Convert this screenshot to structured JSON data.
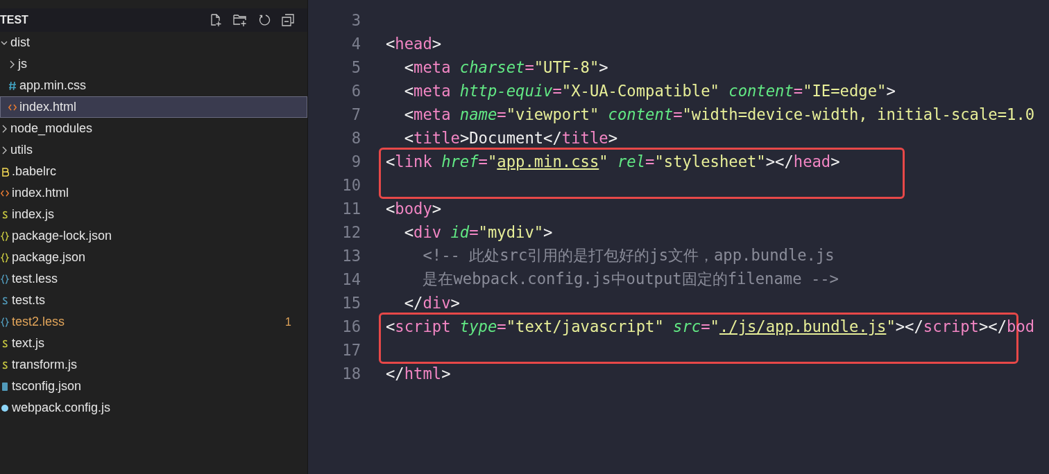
{
  "explorer": {
    "title": "TEST",
    "tree": [
      {
        "name": "dist",
        "kind": "folder",
        "expanded": true,
        "selected": false,
        "children": [
          {
            "name": "js",
            "kind": "folder",
            "expanded": false,
            "selected": false
          },
          {
            "name": "app.min.css",
            "kind": "css",
            "selected": false
          },
          {
            "name": "index.html",
            "kind": "html",
            "selected": true
          }
        ]
      },
      {
        "name": "node_modules",
        "kind": "folder",
        "expanded": false,
        "selected": false
      },
      {
        "name": "utils",
        "kind": "folder",
        "expanded": false,
        "selected": false
      },
      {
        "name": ".babelrc",
        "kind": "babel",
        "selected": false
      },
      {
        "name": "index.html",
        "kind": "html",
        "selected": false
      },
      {
        "name": "index.js",
        "kind": "js",
        "selected": false
      },
      {
        "name": "package-lock.json",
        "kind": "json",
        "selected": false
      },
      {
        "name": "package.json",
        "kind": "json",
        "selected": false
      },
      {
        "name": "test.less",
        "kind": "less",
        "selected": false
      },
      {
        "name": "test.ts",
        "kind": "ts",
        "selected": false
      },
      {
        "name": "test2.less",
        "kind": "less",
        "selected": false,
        "warning": true,
        "badge": "1"
      },
      {
        "name": "text.js",
        "kind": "js",
        "selected": false
      },
      {
        "name": "transform.js",
        "kind": "js",
        "selected": false
      },
      {
        "name": "tsconfig.json",
        "kind": "tsconfig",
        "selected": false
      },
      {
        "name": "webpack.config.js",
        "kind": "webpack",
        "selected": false
      }
    ]
  },
  "editor": {
    "blocks": [
      {
        "kind": "plain",
        "lines": [
          {
            "number": "3"
          },
          {
            "number": "4",
            "tokens": [
              {
                "kind": "punct",
                "text": "<"
              },
              {
                "kind": "tag",
                "text": "head"
              },
              {
                "kind": "punct",
                "text": ">"
              }
            ]
          },
          {
            "number": "5",
            "tokens": [
              {
                "kind": "punct",
                "text": "  <"
              },
              {
                "kind": "tag",
                "text": "meta"
              },
              {
                "kind": "attr",
                "text": " charset"
              },
              {
                "kind": "tag",
                "text": "="
              },
              {
                "kind": "string",
                "text": "\"UTF-8\""
              },
              {
                "kind": "punct",
                "text": ">"
              }
            ]
          },
          {
            "number": "6",
            "tokens": [
              {
                "kind": "punct",
                "text": "  <"
              },
              {
                "kind": "tag",
                "text": "meta"
              },
              {
                "kind": "attr",
                "text": " http-equiv"
              },
              {
                "kind": "tag",
                "text": "="
              },
              {
                "kind": "string",
                "text": "\"X-UA-Compatible\""
              },
              {
                "kind": "attr",
                "text": " content"
              },
              {
                "kind": "tag",
                "text": "="
              },
              {
                "kind": "string",
                "text": "\"IE=edge\""
              },
              {
                "kind": "punct",
                "text": ">"
              }
            ]
          },
          {
            "number": "7",
            "tokens": [
              {
                "kind": "punct",
                "text": "  <"
              },
              {
                "kind": "tag",
                "text": "meta"
              },
              {
                "kind": "attr",
                "text": " name"
              },
              {
                "kind": "tag",
                "text": "="
              },
              {
                "kind": "string",
                "text": "\"viewport\""
              },
              {
                "kind": "attr",
                "text": " content"
              },
              {
                "kind": "tag",
                "text": "="
              },
              {
                "kind": "string",
                "text": "\"width=device-width, initial-scale=1.0"
              }
            ]
          },
          {
            "number": "8",
            "tokens": [
              {
                "kind": "punct",
                "text": "  <"
              },
              {
                "kind": "tag",
                "text": "title"
              },
              {
                "kind": "punct",
                "text": ">Document</"
              },
              {
                "kind": "tag",
                "text": "title"
              },
              {
                "kind": "punct",
                "text": ">"
              }
            ]
          }
        ]
      },
      {
        "kind": "boxed",
        "lines": [
          {
            "number": "9",
            "tokens": [
              {
                "kind": "punct",
                "text": "<"
              },
              {
                "kind": "tag",
                "text": "link"
              },
              {
                "kind": "attr",
                "text": " href"
              },
              {
                "kind": "tag",
                "text": "="
              },
              {
                "kind": "string",
                "text": "\""
              },
              {
                "kind": "link",
                "text": "app.min.css"
              },
              {
                "kind": "string",
                "text": "\""
              },
              {
                "kind": "attr",
                "text": " rel"
              },
              {
                "kind": "tag",
                "text": "="
              },
              {
                "kind": "string",
                "text": "\"stylesheet\""
              },
              {
                "kind": "punct",
                "text": "></"
              },
              {
                "kind": "tag",
                "text": "head"
              },
              {
                "kind": "punct",
                "text": ">"
              }
            ]
          },
          {
            "number": "10"
          }
        ]
      },
      {
        "kind": "plain",
        "lines": [
          {
            "number": "11",
            "tokens": [
              {
                "kind": "punct",
                "text": "<"
              },
              {
                "kind": "tag",
                "text": "body"
              },
              {
                "kind": "punct",
                "text": ">"
              }
            ]
          },
          {
            "number": "12",
            "tokens": [
              {
                "kind": "punct",
                "text": "  <"
              },
              {
                "kind": "tag",
                "text": "div"
              },
              {
                "kind": "attr",
                "text": " id"
              },
              {
                "kind": "tag",
                "text": "="
              },
              {
                "kind": "string",
                "text": "\"mydiv\""
              },
              {
                "kind": "punct",
                "text": ">"
              }
            ]
          },
          {
            "number": "13",
            "tokens": [
              {
                "kind": "comment",
                "text": "    <!-- 此处src引用的是打包好的js文件，app.bundle.js"
              }
            ]
          },
          {
            "number": "14",
            "tokens": [
              {
                "kind": "comment",
                "text": "    是在webpack.config.js中output固定的filename -->"
              }
            ]
          },
          {
            "number": "15",
            "tokens": [
              {
                "kind": "punct",
                "text": "  </"
              },
              {
                "kind": "tag",
                "text": "div"
              },
              {
                "kind": "punct",
                "text": ">"
              }
            ]
          }
        ]
      },
      {
        "kind": "boxed",
        "lines": [
          {
            "number": "16",
            "tokens": [
              {
                "kind": "punct",
                "text": "<"
              },
              {
                "kind": "tag",
                "text": "script"
              },
              {
                "kind": "attr",
                "text": " type"
              },
              {
                "kind": "tag",
                "text": "="
              },
              {
                "kind": "string",
                "text": "\"text/javascript\""
              },
              {
                "kind": "attr",
                "text": " src"
              },
              {
                "kind": "tag",
                "text": "="
              },
              {
                "kind": "string",
                "text": "\""
              },
              {
                "kind": "link",
                "text": "./js/app.bundle.js"
              },
              {
                "kind": "string",
                "text": "\""
              },
              {
                "kind": "punct",
                "text": "></"
              },
              {
                "kind": "tag",
                "text": "script"
              },
              {
                "kind": "punct",
                "text": "></"
              },
              {
                "kind": "tag",
                "text": "bod"
              }
            ]
          },
          {
            "number": "17"
          }
        ]
      },
      {
        "kind": "plain",
        "lines": [
          {
            "number": "18",
            "tokens": [
              {
                "kind": "punct",
                "text": "</"
              },
              {
                "kind": "tag",
                "text": "html"
              },
              {
                "kind": "punct",
                "text": ">"
              }
            ]
          }
        ]
      }
    ]
  }
}
